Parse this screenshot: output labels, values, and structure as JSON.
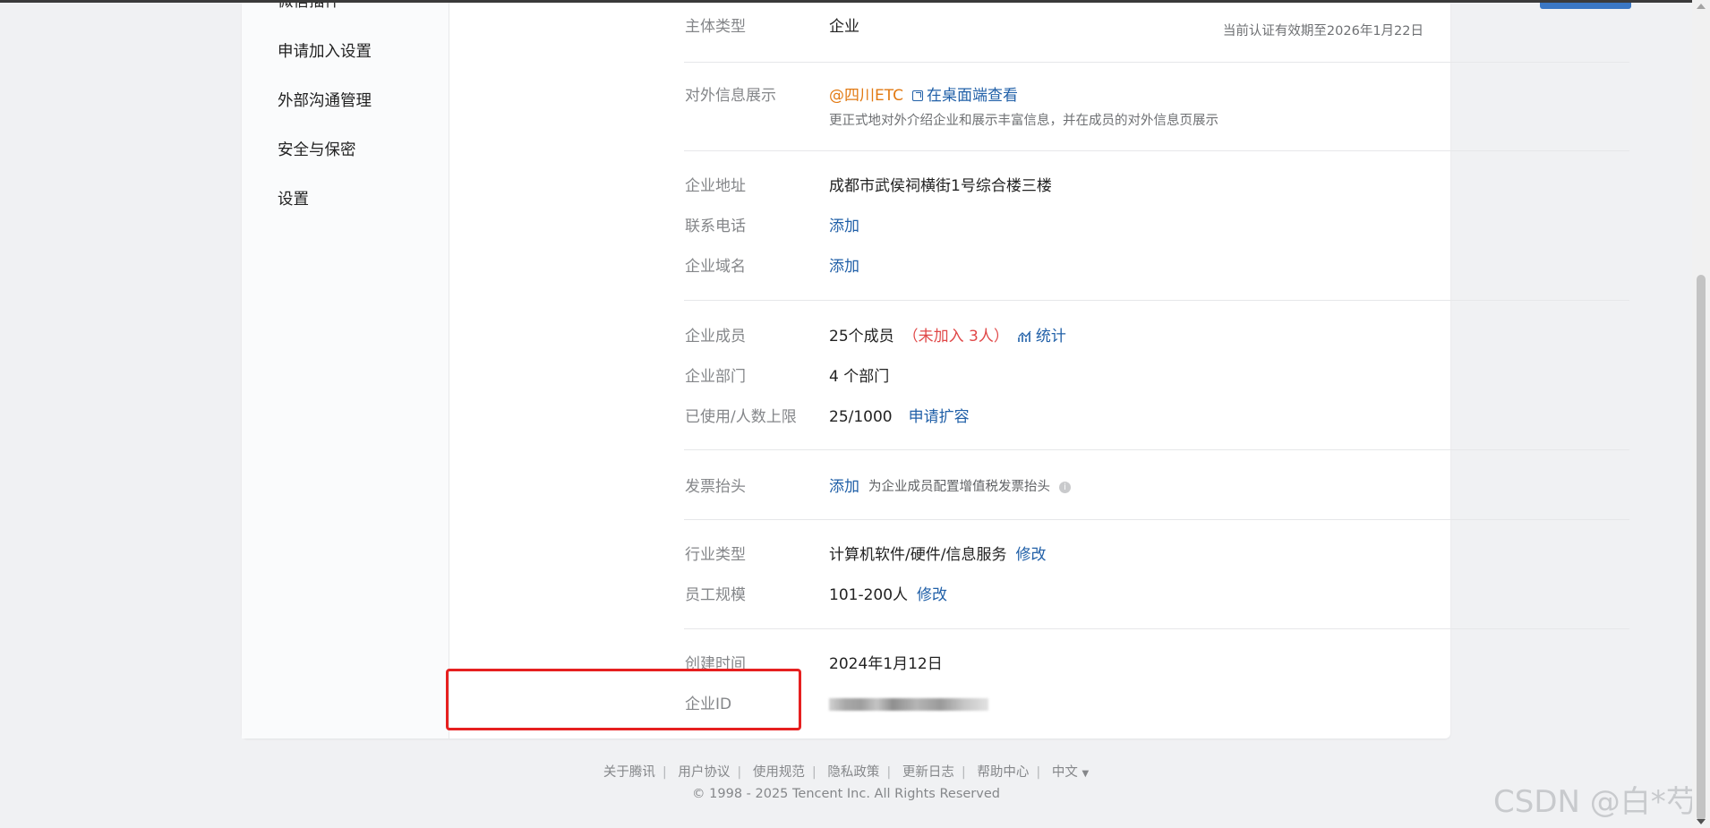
{
  "sidebar": {
    "items": [
      {
        "label": "微信插件"
      },
      {
        "label": "申请加入设置"
      },
      {
        "label": "外部沟通管理"
      },
      {
        "label": "安全与保密"
      },
      {
        "label": "设置"
      }
    ]
  },
  "info": {
    "cert_note": "当前认证有效期至2026年1月22日",
    "entity_type": {
      "label": "主体类型",
      "value": "企业"
    },
    "external_display": {
      "label": "对外信息展示",
      "handle": "@四川ETC",
      "view_link": "在桌面端查看",
      "desc": "更正式地对外介绍企业和展示丰富信息，并在成员的对外信息页展示"
    },
    "address": {
      "label": "企业地址",
      "value": "成都市武侯祠横街1号综合楼三楼"
    },
    "phone": {
      "label": "联系电话",
      "action": "添加"
    },
    "domain": {
      "label": "企业域名",
      "action": "添加"
    },
    "members": {
      "label": "企业成员",
      "value": "25个成员",
      "not_joined": "（未加入 3人）",
      "stats_link": "统计"
    },
    "departments": {
      "label": "企业部门",
      "value": "4 个部门"
    },
    "usage_limit": {
      "label": "已使用/人数上限",
      "value": "25/1000",
      "action": "申请扩容"
    },
    "invoice": {
      "label": "发票抬头",
      "action": "添加",
      "note": "为企业成员配置增值税发票抬头"
    },
    "industry": {
      "label": "行业类型",
      "value": "计算机软件/硬件/信息服务",
      "action": "修改"
    },
    "staff_size": {
      "label": "员工规模",
      "value": "101-200人",
      "action": "修改"
    },
    "created": {
      "label": "创建时间",
      "value": "2024年1月12日"
    },
    "corp_id": {
      "label": "企业ID"
    }
  },
  "footer": {
    "links": [
      "关于腾讯",
      "用户协议",
      "使用规范",
      "隐私政策",
      "更新日志",
      "帮助中心",
      "中文"
    ],
    "lang_arrow": "▼",
    "copyright": "© 1998 - 2025 Tencent Inc. All Rights Reserved"
  },
  "watermark": "CSDN @白*芍",
  "colors": {
    "link": "#2160a8",
    "orange": "#e27a13",
    "red": "#e04848",
    "highlight": "#e62020"
  }
}
